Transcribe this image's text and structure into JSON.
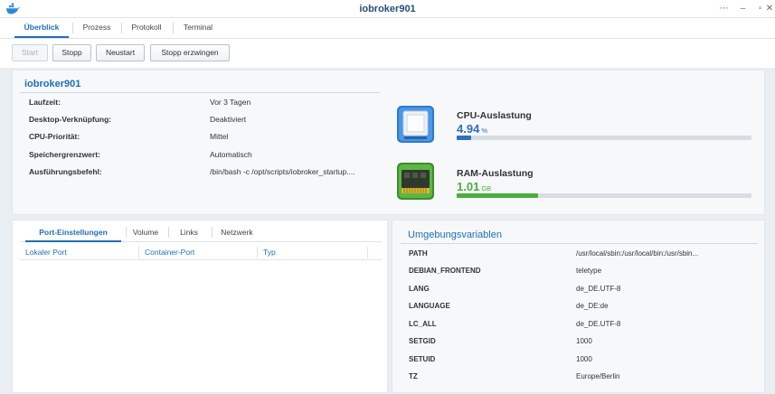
{
  "window": {
    "title": "iobroker901"
  },
  "tabs": [
    "Überblick",
    "Prozess",
    "Protokoll",
    "Terminal"
  ],
  "actions": {
    "start": "Start",
    "stop": "Stopp",
    "restart": "Neustart",
    "force_stop": "Stopp erzwingen"
  },
  "overview": {
    "name": "iobroker901",
    "rows": [
      {
        "label": "Laufzeit:",
        "value": "Vor 3 Tagen"
      },
      {
        "label": "Desktop-Verknüpfung:",
        "value": "Deaktiviert"
      },
      {
        "label": "CPU-Priorität:",
        "value": "Mittel"
      },
      {
        "label": "Speichergrenzwert:",
        "value": "Automatisch"
      },
      {
        "label": "Ausführungsbefehl:",
        "value": "/bin/bash -c /opt/scripts/iobroker_startup...."
      }
    ],
    "cpu": {
      "label": "CPU-Auslastung",
      "value": "4.94",
      "unit": "%",
      "percent": 4.94,
      "color": "#2f6fbd"
    },
    "ram": {
      "label": "RAM-Auslastung",
      "value": "1.01",
      "unit": "GB",
      "percent": 27.5,
      "color": "#4cae3c"
    }
  },
  "ports": {
    "tabs": [
      "Port-Einstellungen",
      "Volume",
      "Links",
      "Netzwerk"
    ],
    "columns": [
      "Lokaler Port",
      "Container-Port",
      "Typ"
    ]
  },
  "env": {
    "title": "Umgebungsvariablen",
    "vars": [
      {
        "name": "PATH",
        "value": "/usr/local/sbin:/usr/local/bin:/usr/sbin..."
      },
      {
        "name": "DEBIAN_FRONTEND",
        "value": "teletype"
      },
      {
        "name": "LANG",
        "value": "de_DE.UTF-8"
      },
      {
        "name": "LANGUAGE",
        "value": "de_DE:de"
      },
      {
        "name": "LC_ALL",
        "value": "de_DE.UTF-8"
      },
      {
        "name": "SETGID",
        "value": "1000"
      },
      {
        "name": "SETUID",
        "value": "1000"
      },
      {
        "name": "TZ",
        "value": "Europe/Berlin"
      }
    ]
  }
}
